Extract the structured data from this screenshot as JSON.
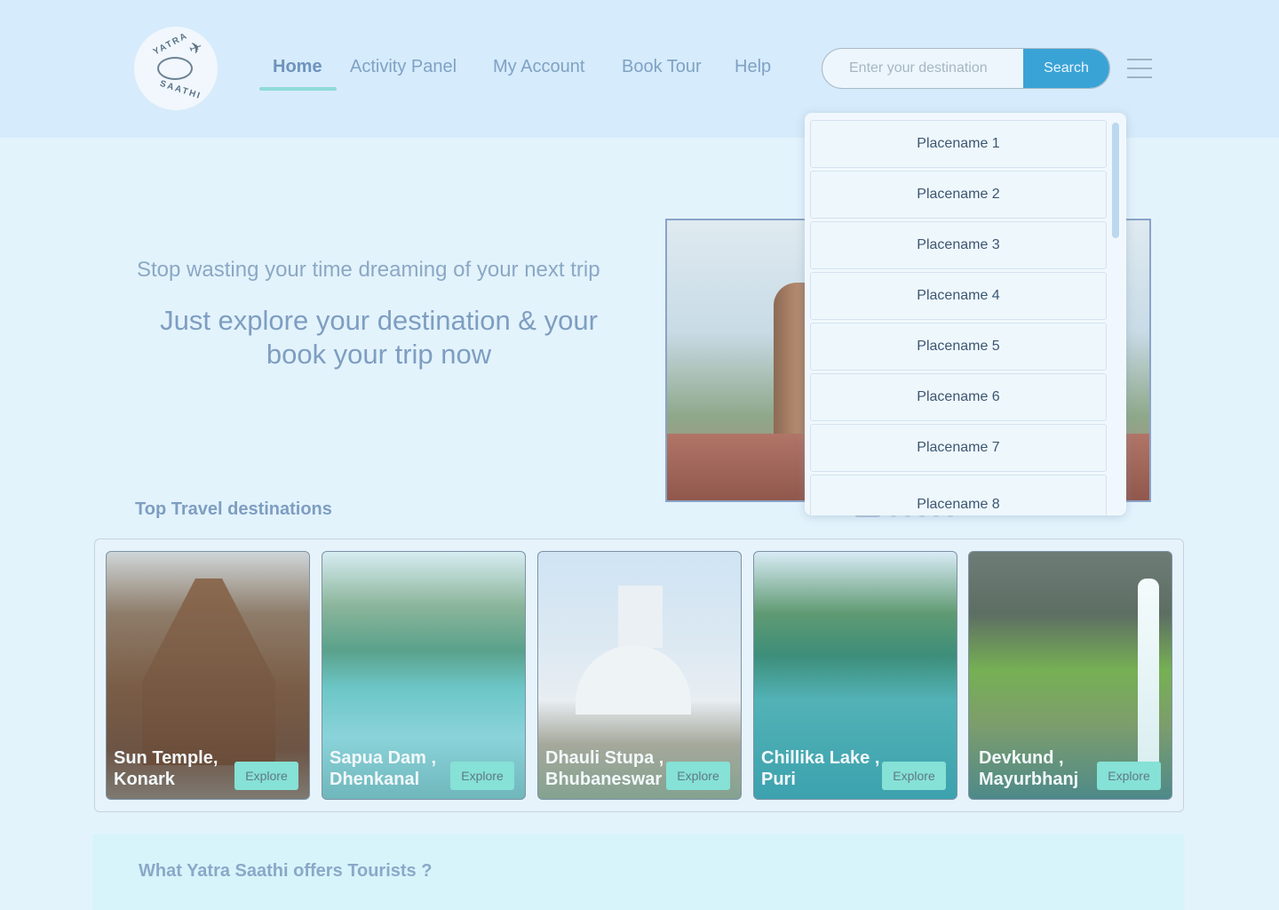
{
  "logo": {
    "top_text": "YATRA",
    "bottom_text": "SAATHI",
    "icon": "plane-icon"
  },
  "nav": {
    "items": [
      {
        "label": "Home",
        "active": true
      },
      {
        "label": "Activity Panel",
        "active": false
      },
      {
        "label": "My Account",
        "active": false
      },
      {
        "label": "Book Tour",
        "active": false
      },
      {
        "label": "Help",
        "active": false
      }
    ]
  },
  "search": {
    "placeholder": "Enter your destination",
    "value": "",
    "button_label": "Search"
  },
  "menu": {
    "icon": "hamburger-menu-icon"
  },
  "dropdown": {
    "items": [
      "Placename 1",
      "Placename 2",
      "Placename 3",
      "Placename 4",
      "Placename 5",
      "Placename 6",
      "Placename 7",
      "Placename 8"
    ]
  },
  "hero": {
    "subtitle": "Stop wasting your time dreaming of your next trip",
    "title": "Just explore your destination & your book your trip now"
  },
  "destinations": {
    "title": "Top Travel destinations",
    "cards": [
      {
        "name": "Sun Temple, Konark",
        "button_label": "Explore"
      },
      {
        "name": "Sapua Dam , Dhenkanal",
        "button_label": "Explore"
      },
      {
        "name": "Dhauli Stupa , Bhubaneswar",
        "button_label": "Explore"
      },
      {
        "name": "Chillika Lake , Puri",
        "button_label": "Explore"
      },
      {
        "name": "Devkund , Mayurbhanj",
        "button_label": "Explore"
      }
    ]
  },
  "offers": {
    "title": "What Yatra Saathi offers Tourists ?"
  },
  "colors": {
    "accent": "#3aa3d6",
    "underline": "#8fdbd8",
    "explore": "#86e1d6"
  }
}
